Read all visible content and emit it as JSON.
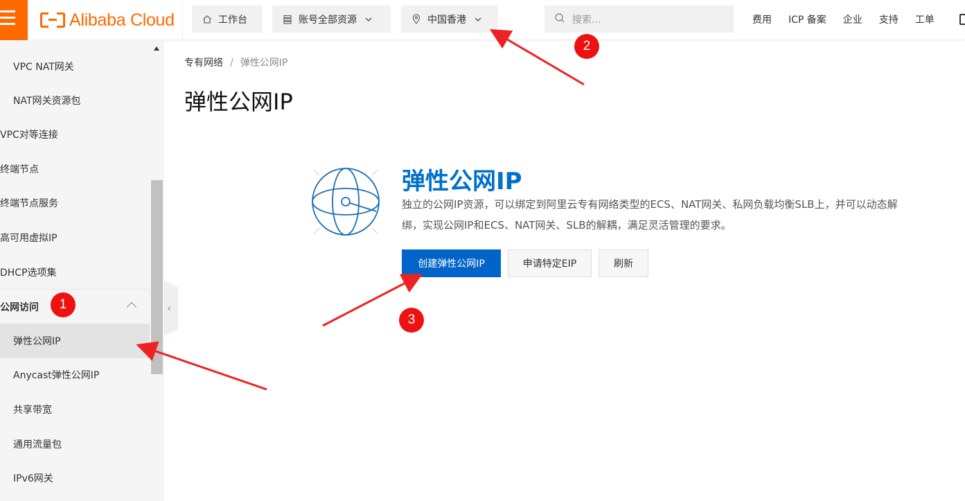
{
  "topbar": {
    "brand": "Alibaba Cloud",
    "workbench": "工作台",
    "resources": "账号全部资源",
    "region": "中国香港",
    "search_placeholder": "搜索...",
    "links": [
      "费用",
      "ICP 备案",
      "企业",
      "支持",
      "工单"
    ]
  },
  "sidebar": {
    "items": [
      {
        "label": "VPC NAT网关"
      },
      {
        "label": "NAT网关资源包"
      },
      {
        "label": "VPC对等连接"
      },
      {
        "label": "终端节点"
      },
      {
        "label": "终端节点服务"
      },
      {
        "label": "高可用虚拟IP"
      },
      {
        "label": "DHCP选项集"
      },
      {
        "label": "公网访问"
      },
      {
        "label": "弹性公网IP"
      },
      {
        "label": "Anycast弹性公网IP"
      },
      {
        "label": "共享带宽"
      },
      {
        "label": "通用流量包"
      },
      {
        "label": "IPv6网关"
      }
    ]
  },
  "breadcrumb": {
    "parent": "专有网络",
    "separator": "/",
    "current": "弹性公网IP"
  },
  "page_title": "弹性公网IP",
  "hero": {
    "title": "弹性公网IP",
    "desc_line1": "独立的公网IP资源，可以绑定到阿里云专有网络类型的ECS、NAT网关、私网负载均衡SLB上，并可以动态解",
    "desc_line2": "绑，实现公网IP和ECS、NAT网关、SLB的解耦，满足灵活管理的要求。"
  },
  "actions": {
    "create": "创建弹性公网IP",
    "apply": "申请特定EIP",
    "refresh": "刷新"
  },
  "annotations": {
    "badges": [
      "1",
      "2",
      "3"
    ]
  },
  "colors": {
    "brand_orange": "#ff6a00",
    "primary_blue": "#0064c8",
    "title_blue": "#0070cc",
    "annotation_red": "#ee1111"
  }
}
